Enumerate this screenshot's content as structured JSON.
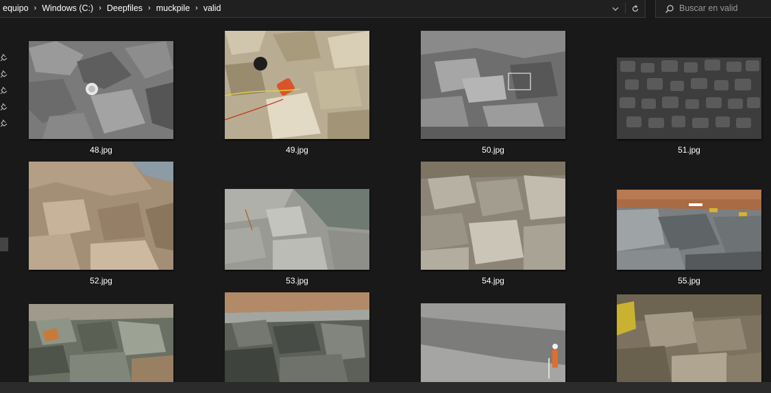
{
  "breadcrumb": [
    "equipo",
    "Windows (C:)",
    "Deepfiles",
    "muckpile",
    "valid"
  ],
  "search": {
    "placeholder": "Buscar en valid"
  },
  "icons": {
    "chevron": "chevron-down-icon",
    "refresh": "refresh-icon",
    "search": "search-icon",
    "pin": "pin-icon"
  },
  "files": [
    {
      "name": "48.jpg",
      "theme": "gray"
    },
    {
      "name": "49.jpg",
      "theme": "beige"
    },
    {
      "name": "50.jpg",
      "theme": "gray"
    },
    {
      "name": "51.jpg",
      "theme": "dark"
    },
    {
      "name": "52.jpg",
      "theme": "tan"
    },
    {
      "name": "53.jpg",
      "theme": "lightgray"
    },
    {
      "name": "54.jpg",
      "theme": "tan"
    },
    {
      "name": "55.jpg",
      "theme": "site"
    },
    {
      "name": "",
      "theme": "green"
    },
    {
      "name": "",
      "theme": "green"
    },
    {
      "name": "",
      "theme": "gray"
    },
    {
      "name": "",
      "theme": "tan"
    }
  ]
}
